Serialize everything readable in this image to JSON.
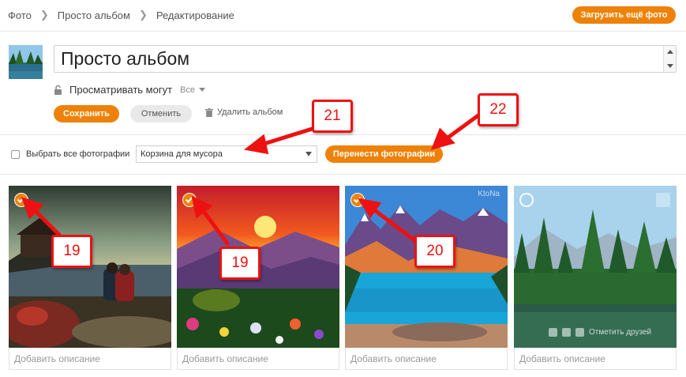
{
  "breadcrumb": [
    "Фото",
    "Просто альбом",
    "Редактирование"
  ],
  "header": {
    "upload_label": "Загрузить ещё фото"
  },
  "album": {
    "title": "Просто альбом",
    "privacy_label": "Просматривать могут",
    "privacy_value": "Все",
    "save_label": "Сохранить",
    "cancel_label": "Отменить",
    "delete_label": "Удалить альбом"
  },
  "toolbar": {
    "select_all_label": "Выбрать все фотографии",
    "target_album": "Корзина для мусора",
    "move_label": "Перенести фотографии"
  },
  "photos": [
    {
      "description_placeholder": "Добавить описание",
      "selected": true
    },
    {
      "description_placeholder": "Добавить описание",
      "selected": true
    },
    {
      "description_placeholder": "Добавить описание",
      "selected": true,
      "watermark": "KtoNa"
    },
    {
      "description_placeholder": "Добавить описание",
      "selected": false,
      "overlay_text": "Отметить друзей"
    }
  ],
  "callouts": [
    "19",
    "19",
    "20",
    "21",
    "22"
  ],
  "colors": {
    "accent": "#ee8208",
    "callout": "#ee1111"
  }
}
